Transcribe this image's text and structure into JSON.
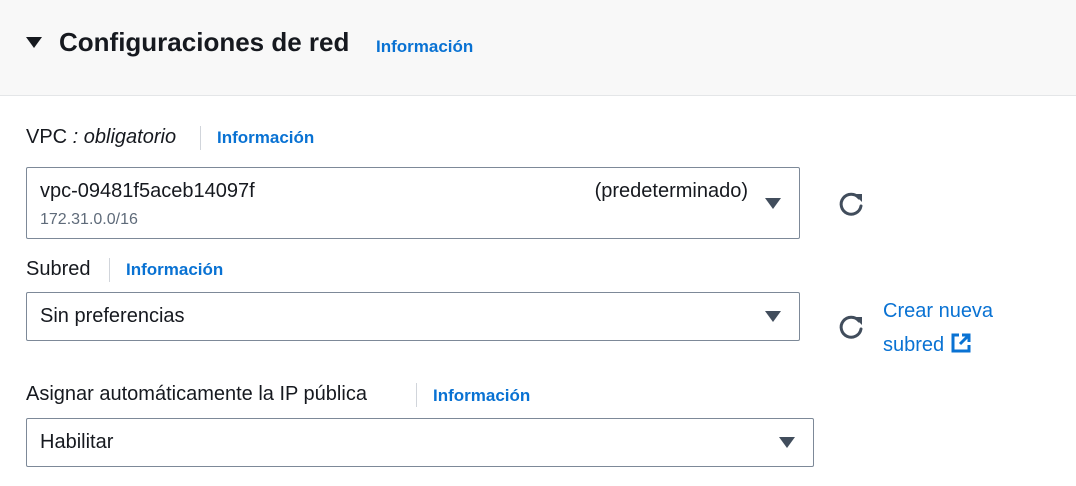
{
  "section": {
    "title": "Configuraciones de red",
    "info_label": "Información"
  },
  "vpc": {
    "label_main": "VPC",
    "label_suffix": " : obligatorio",
    "info_label": "Información",
    "selected_value": "vpc-09481f5aceb14097f",
    "selected_tag": "(predeterminado)",
    "selected_description": "172.31.0.0/16"
  },
  "subnet": {
    "label": "Subred",
    "info_label": "Información",
    "selected_value": "Sin preferencias",
    "create_link_line1": "Crear nueva",
    "create_link_line2": "subred"
  },
  "public_ip": {
    "label": "Asignar automáticamente la IP pública",
    "info_label": "Información",
    "selected_value": "Habilitar"
  },
  "colors": {
    "link": "#0972d3",
    "text": "#16191f",
    "header_bg": "#f8f8f8",
    "border": "#7d8998"
  },
  "icons": {
    "section_toggle": "caret-down-icon",
    "refresh": "refresh-icon",
    "dropdown": "caret-down-icon",
    "external": "external-link-icon"
  }
}
